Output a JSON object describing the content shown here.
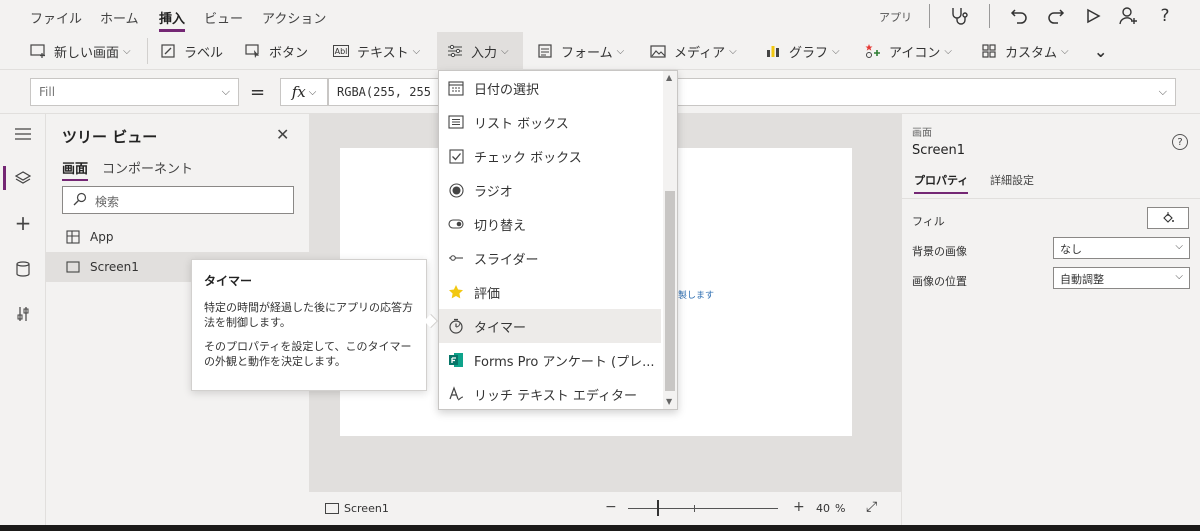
{
  "menubar": {
    "items": [
      "ファイル",
      "ホーム",
      "挿入",
      "ビュー",
      "アクション"
    ],
    "active_index": 2,
    "app_label": "アプリ"
  },
  "ribbon": {
    "items": [
      {
        "label": "新しい画面",
        "icon": "new-screen-icon",
        "has_chevron": true
      },
      {
        "label": "ラベル",
        "icon": "label-icon",
        "has_chevron": false
      },
      {
        "label": "ボタン",
        "icon": "button-icon",
        "has_chevron": false
      },
      {
        "label": "テキスト",
        "icon": "text-icon",
        "has_chevron": true
      },
      {
        "label": "入力",
        "icon": "input-icon",
        "has_chevron": true
      },
      {
        "label": "フォーム",
        "icon": "form-icon",
        "has_chevron": true
      },
      {
        "label": "メディア",
        "icon": "media-icon",
        "has_chevron": true
      },
      {
        "label": "グラフ",
        "icon": "chart-icon",
        "has_chevron": true
      },
      {
        "label": "アイコン",
        "icon": "icons-icon",
        "has_chevron": true
      },
      {
        "label": "カスタム",
        "icon": "custom-icon",
        "has_chevron": true
      }
    ]
  },
  "formula": {
    "property": "Fill",
    "value": "RGBA(255, 255"
  },
  "tree": {
    "title": "ツリー ビュー",
    "tabs": [
      "画面",
      "コンポーネント"
    ],
    "search_placeholder": "検索",
    "nodes": [
      "App",
      "Screen1"
    ]
  },
  "canvas": {
    "hint_text": "製します"
  },
  "status": {
    "screen": "Screen1",
    "zoom": "40",
    "percent": "%"
  },
  "right_panel": {
    "kind": "画面",
    "name": "Screen1",
    "tabs": [
      "プロパティ",
      "詳細設定"
    ],
    "fill_label": "フィル",
    "bg_image_label": "背景の画像",
    "bg_image_value": "なし",
    "image_position_label": "画像の位置",
    "image_position_value": "自動調整"
  },
  "input_menu": {
    "items": [
      {
        "label": "日付の選択",
        "icon": "calendar-icon"
      },
      {
        "label": "リスト ボックス",
        "icon": "listbox-icon"
      },
      {
        "label": "チェック ボックス",
        "icon": "checkbox-icon"
      },
      {
        "label": "ラジオ",
        "icon": "radio-icon"
      },
      {
        "label": "切り替え",
        "icon": "toggle-icon"
      },
      {
        "label": "スライダー",
        "icon": "slider-icon"
      },
      {
        "label": "評価",
        "icon": "star-icon"
      },
      {
        "label": "タイマー",
        "icon": "timer-icon"
      },
      {
        "label": "Forms Pro アンケート (プレ...",
        "icon": "forms-pro-icon"
      },
      {
        "label": "リッチ テキスト エディター",
        "icon": "rich-text-icon"
      }
    ],
    "highlighted_index": 7
  },
  "tooltip": {
    "title": "タイマー",
    "body1": "特定の時間が経過した後にアプリの応答方法を制御します。",
    "body2": "そのプロパティを設定して、このタイマーの外観と動作を決定します。"
  },
  "colors": {
    "accent": "#742774",
    "star": "#f2c811",
    "forms_green": "#077568"
  }
}
